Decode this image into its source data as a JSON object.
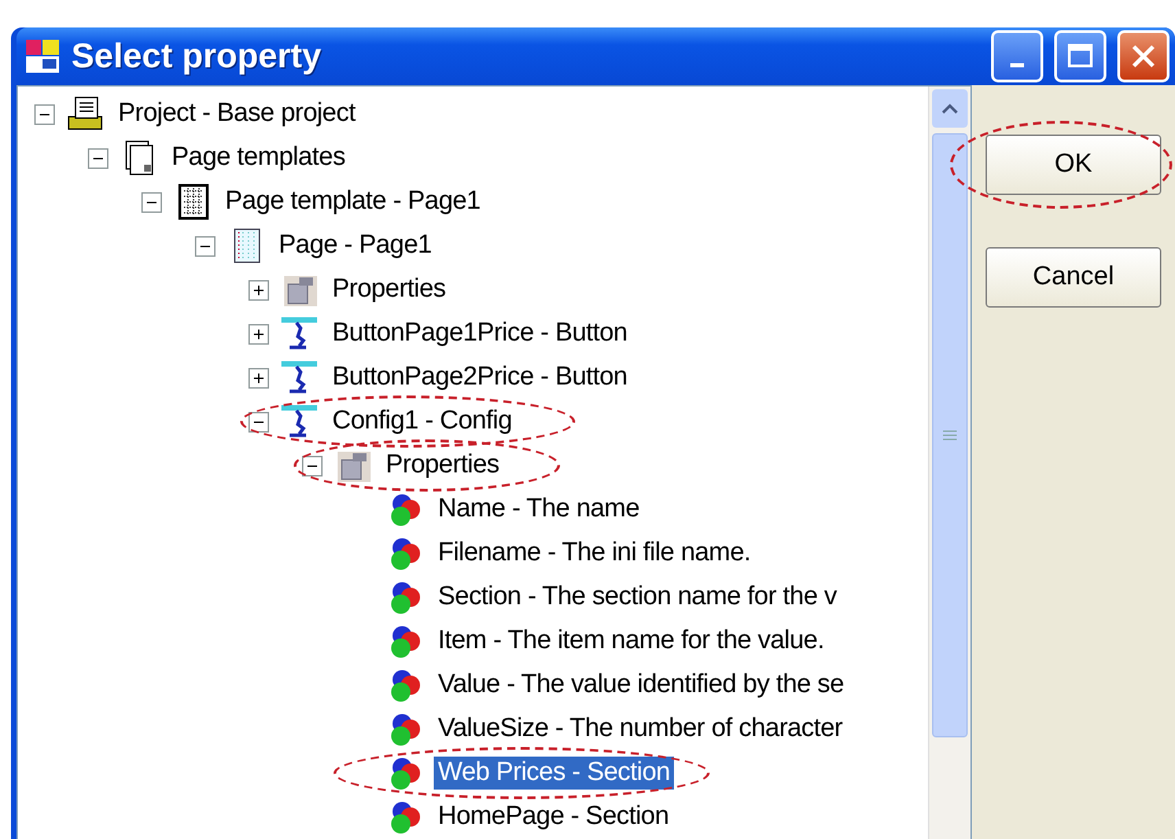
{
  "window": {
    "title": "Select property"
  },
  "tree": [
    {
      "label": "Project - Base project",
      "kind": "project",
      "expanded": true,
      "selected": false,
      "children": [
        {
          "label": "Page templates",
          "kind": "templates",
          "expanded": true,
          "selected": false,
          "children": [
            {
              "label": "Page template - Page1",
              "kind": "template",
              "expanded": true,
              "selected": false,
              "children": [
                {
                  "label": "Page - Page1",
                  "kind": "page",
                  "expanded": true,
                  "selected": false,
                  "children": [
                    {
                      "label": "Properties",
                      "kind": "properties",
                      "expanded": false,
                      "selected": false
                    },
                    {
                      "label": "ButtonPage1Price - Button",
                      "kind": "button",
                      "expanded": false,
                      "selected": false
                    },
                    {
                      "label": "ButtonPage2Price - Button",
                      "kind": "button",
                      "expanded": false,
                      "selected": false
                    },
                    {
                      "label": "Config1 - Config",
                      "kind": "button",
                      "expanded": true,
                      "selected": false,
                      "circled": true,
                      "children": [
                        {
                          "label": "Properties",
                          "kind": "properties",
                          "expanded": true,
                          "selected": false,
                          "circled": true,
                          "children": [
                            {
                              "label": "Name - The name",
                              "kind": "field",
                              "selected": false
                            },
                            {
                              "label": "Filename - The ini file name.",
                              "kind": "field",
                              "selected": false
                            },
                            {
                              "label": "Section - The section name for the v",
                              "kind": "field",
                              "selected": false
                            },
                            {
                              "label": "Item - The item name for the value.",
                              "kind": "field",
                              "selected": false
                            },
                            {
                              "label": "Value - The value identified by the se",
                              "kind": "field",
                              "selected": false
                            },
                            {
                              "label": "ValueSize - The number of character",
                              "kind": "field",
                              "selected": false
                            },
                            {
                              "label": "Web Prices - Section",
                              "kind": "field",
                              "selected": true,
                              "circled": true
                            },
                            {
                              "label": "HomePage - Section",
                              "kind": "field",
                              "selected": false
                            }
                          ]
                        }
                      ]
                    }
                  ]
                }
              ]
            }
          ]
        }
      ]
    }
  ],
  "buttons": [
    {
      "label": "OK",
      "circled": true
    },
    {
      "label": "Cancel"
    }
  ]
}
